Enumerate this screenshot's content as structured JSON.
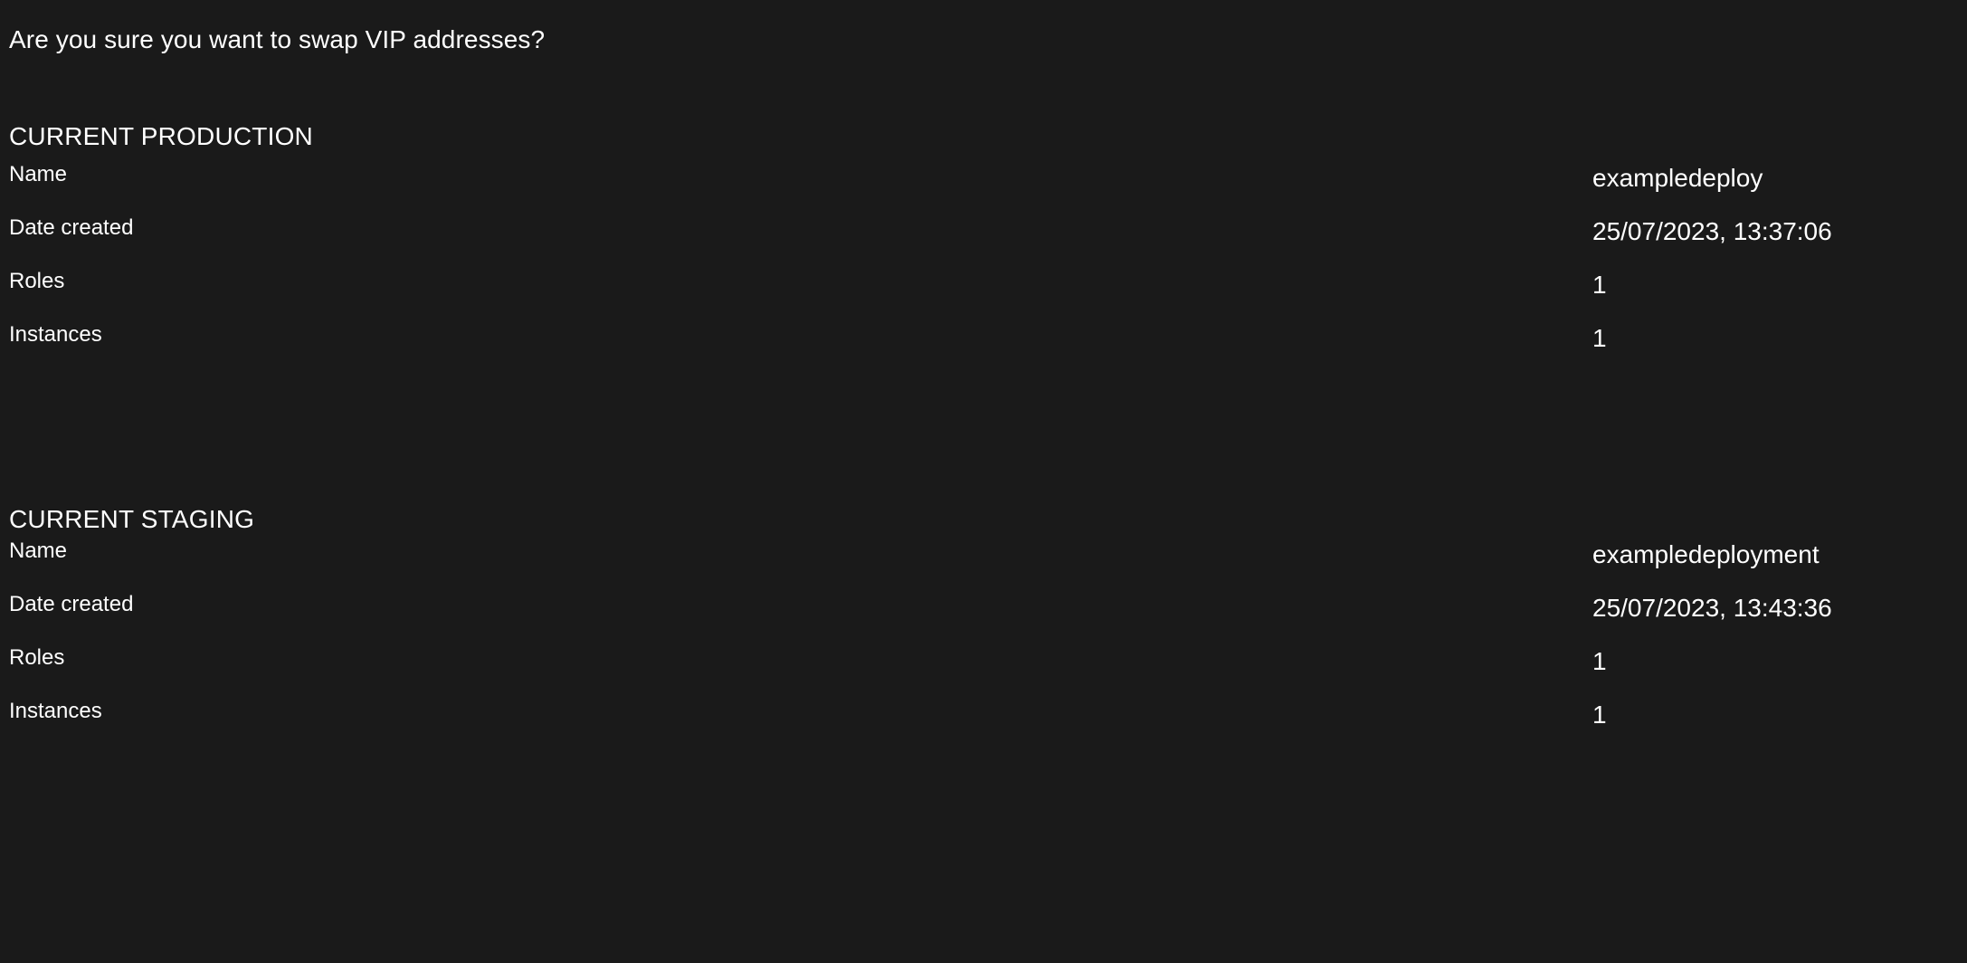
{
  "dialog": {
    "question": "Are you sure you want to swap VIP addresses?",
    "background_color": "#1a1a1a",
    "text_color": "#ffffff"
  },
  "sections": [
    {
      "heading": "CURRENT PRODUCTION",
      "rows": [
        {
          "label": "Name",
          "value": "exampledeploy"
        },
        {
          "label": "Date created",
          "value": "25/07/2023, 13:37:06"
        },
        {
          "label": "Roles",
          "value": "1"
        },
        {
          "label": "Instances",
          "value": "1"
        }
      ]
    },
    {
      "heading": "CURRENT STAGING",
      "rows": [
        {
          "label": "Name",
          "value": "exampledeployment"
        },
        {
          "label": "Date created",
          "value": "25/07/2023, 13:43:36"
        },
        {
          "label": "Roles",
          "value": "1"
        },
        {
          "label": "Instances",
          "value": "1"
        }
      ]
    }
  ]
}
